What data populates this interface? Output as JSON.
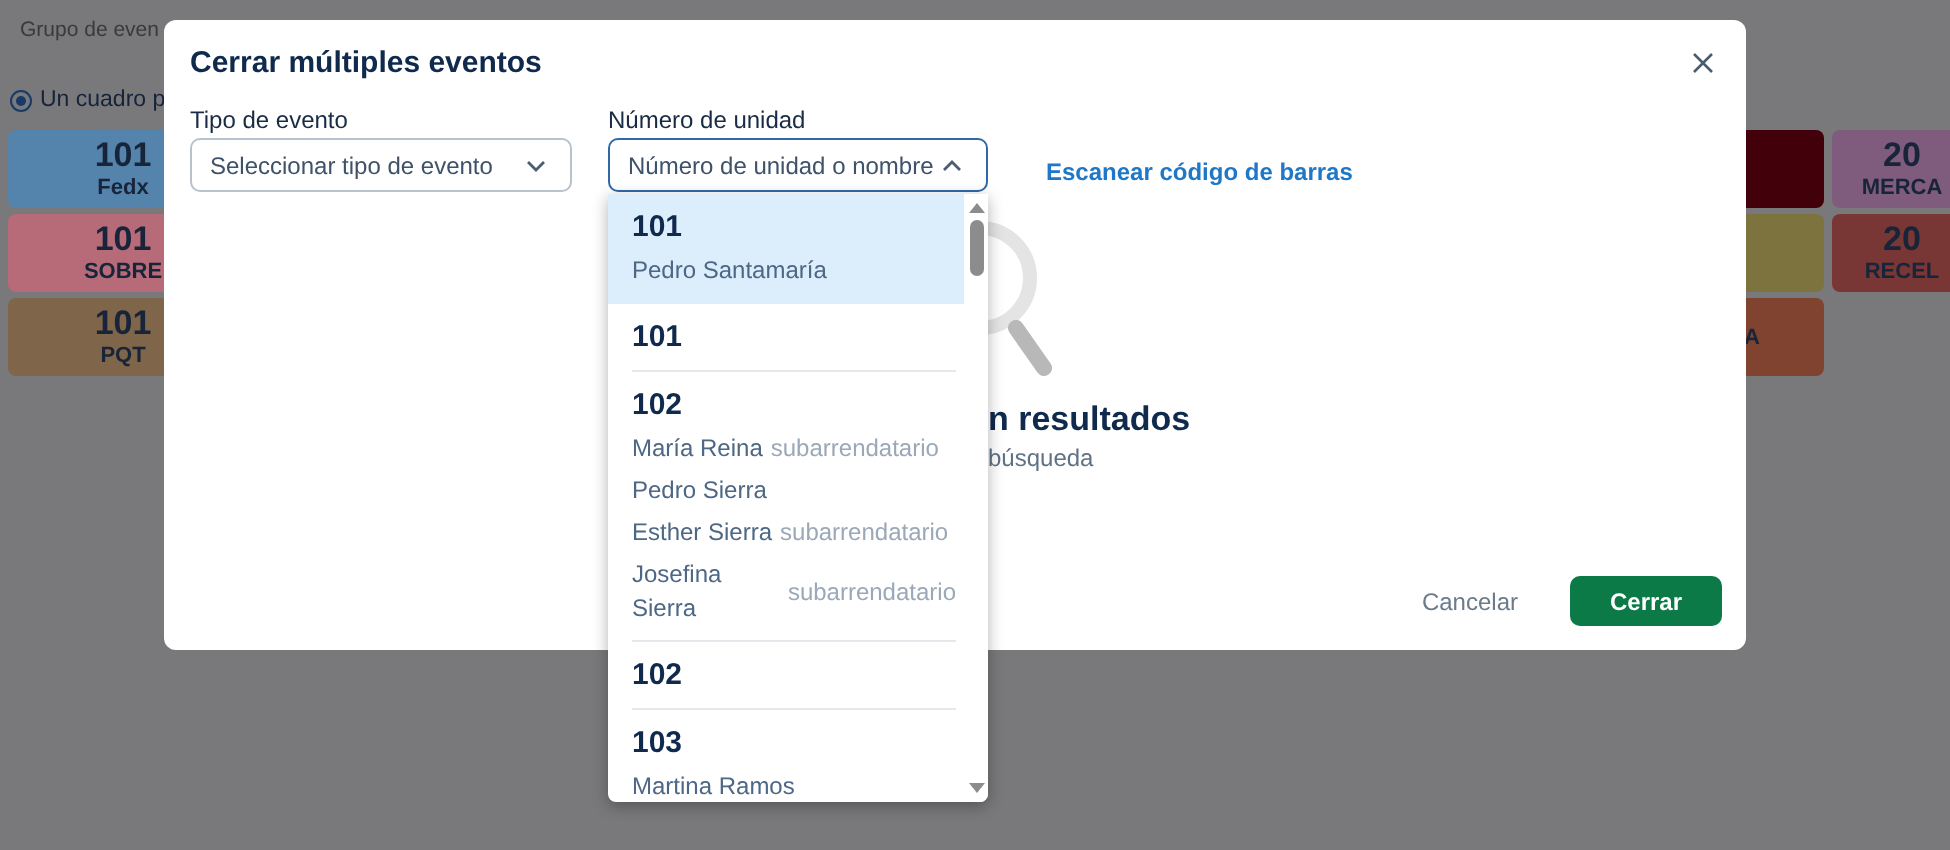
{
  "background": {
    "filter": "Grupo de even",
    "view_option": {
      "label": "Un cuadro p",
      "selected": true
    },
    "tile_columns": [
      {
        "tiles": [
          {
            "unit": "101",
            "label": "Fedx",
            "color": "#5483ab"
          },
          {
            "unit": "101",
            "label": "SOBRE",
            "color": "#b76b78"
          },
          {
            "unit": "101",
            "label": "PQT",
            "color": "#7f6549"
          }
        ]
      },
      {
        "tiles": [
          {
            "color": "#42000a"
          },
          {
            "color": "#7d733f"
          },
          {
            "label": "A",
            "color": "#80432f"
          }
        ]
      },
      {
        "tiles": [
          {
            "unit": "20",
            "label": "MERCA",
            "color": "#7f5b7e"
          },
          {
            "unit": "20",
            "label": "RECEL",
            "color": "#783634"
          }
        ]
      }
    ]
  },
  "modal": {
    "title": "Cerrar múltiples eventos",
    "event_type": {
      "label": "Tipo de evento",
      "placeholder": "Seleccionar tipo de evento",
      "expanded": false
    },
    "unit": {
      "label": "Número de unidad",
      "placeholder": "Número de unidad o nombre",
      "expanded": true
    },
    "scan_link": "Escanear código de barras",
    "empty_state": {
      "title": "n resultados",
      "hint": "búsqueda"
    },
    "buttons": [
      {
        "label": "Cancelar",
        "kind": "secondary"
      },
      {
        "label": "Cerrar",
        "kind": "primary"
      }
    ]
  },
  "unit_options": [
    {
      "unit": "101",
      "selected": true,
      "residents": [
        {
          "name": "Pedro Santamaría"
        }
      ]
    },
    {
      "unit": "101",
      "selected": false
    },
    {
      "unit": "102",
      "selected": false,
      "residents": [
        {
          "name": "María Reina",
          "role": "subarrendatario"
        },
        {
          "name": "Pedro Sierra"
        },
        {
          "name": "Esther Sierra",
          "role": "subarrendatario"
        },
        {
          "name": "Josefina Sierra",
          "role": "subarrendatario"
        }
      ]
    },
    {
      "unit": "102",
      "selected": false
    },
    {
      "unit": "103",
      "selected": false,
      "residents": [
        {
          "name": "Martina Ramos"
        }
      ]
    }
  ]
}
